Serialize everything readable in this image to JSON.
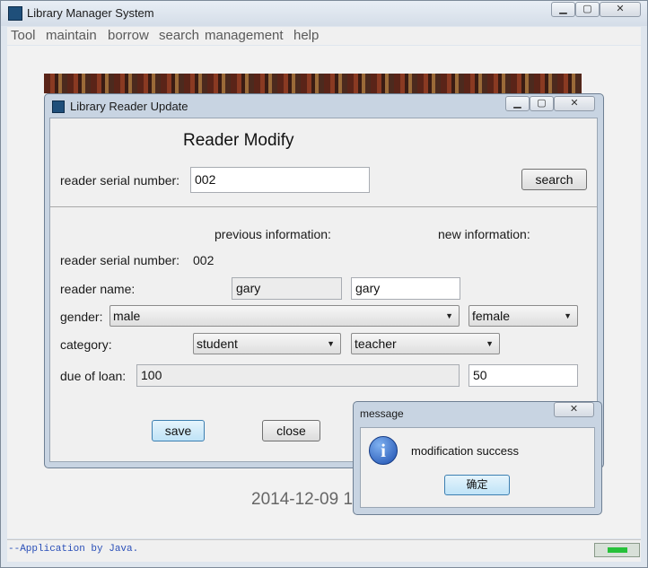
{
  "main_window": {
    "title": "Library Manager System",
    "controls": {
      "minimize": "▁",
      "maximize": "▢",
      "close": "✕"
    }
  },
  "menu": [
    {
      "label": "Tool"
    },
    {
      "label": "maintain"
    },
    {
      "label": "borrow"
    },
    {
      "label": "search"
    },
    {
      "label": "management"
    },
    {
      "label": "help"
    }
  ],
  "reader_update": {
    "title": "Library Reader Update",
    "heading": "Reader Modify",
    "search_label": "reader serial number:",
    "search_value": "002",
    "search_button": "search",
    "previous_header": "previous information:",
    "new_header": "new information:",
    "serial_label": "reader serial number:",
    "serial_value": "002",
    "name_label": "reader name:",
    "name_prev": "gary",
    "name_new": "gary",
    "gender_label": "gender:",
    "gender_prev": "male",
    "gender_new": "female",
    "category_label": "category:",
    "category_prev": "student",
    "category_new": "teacher",
    "loan_label": "due of loan:",
    "loan_prev": "100",
    "loan_new": "50",
    "save_button": "save",
    "close_button": "close"
  },
  "message_dialog": {
    "title": "message",
    "icon": "info-icon",
    "text": "modification success",
    "ok_button": "确定"
  },
  "main_date_text": "2014-12-09 1",
  "status": {
    "text": "--Application by Java."
  }
}
